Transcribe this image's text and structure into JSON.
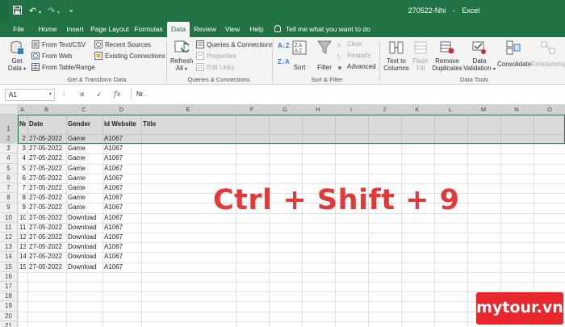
{
  "window": {
    "doc_title": "270522-Nhi",
    "app": "Excel",
    "separator": "-"
  },
  "quick_access": {
    "dropdown_icon": "customize-dropdown-icon"
  },
  "tabs": [
    "File",
    "Home",
    "Insert",
    "Page Layout",
    "Formulas",
    "Data",
    "Review",
    "View",
    "Help"
  ],
  "active_tab": "Data",
  "tell_me": "Tell me what you want to do",
  "ribbon": {
    "get_data": {
      "line1": "Get",
      "line2": "Data"
    },
    "from_text_csv": "From Text/CSV",
    "from_web": "From Web",
    "from_table_range": "From Table/Range",
    "recent_sources": "Recent Sources",
    "existing_connections": "Existing Connections",
    "refresh_all": {
      "line1": "Refresh",
      "line2": "All"
    },
    "queries_connections": "Queries & Connections",
    "properties": "Properties",
    "edit_links": "Edit Links",
    "sort": "Sort",
    "filter": "Filter",
    "clear": "Clear",
    "reapply": "Reapply",
    "advanced": "Advanced",
    "text_to_columns": {
      "line1": "Text to",
      "line2": "Columns"
    },
    "flash_fill": {
      "line1": "Flash",
      "line2": "Fill"
    },
    "remove_duplicates": {
      "line1": "Remove",
      "line2": "Duplicates"
    },
    "data_validation": {
      "line1": "Data",
      "line2": "Validation"
    },
    "consolidate": "Consolidate",
    "relationships": "Relationships",
    "groups": {
      "get_transform": "Get & Transform Data",
      "queries": "Queries & Connections",
      "sort_filter": "Sort & Filter",
      "data_tools": "Data Tools"
    }
  },
  "formula_bar": {
    "name_box": "A1",
    "fx": "fx",
    "content": "Nr."
  },
  "columns": [
    "A",
    "B",
    "C",
    "D",
    "E",
    "F",
    "G",
    "H",
    "I",
    "J",
    "K",
    "L",
    "M",
    "N",
    "O"
  ],
  "rows": [
    "1",
    "2",
    "3",
    "4",
    "5",
    "6",
    "7",
    "8",
    "9",
    "10",
    "11",
    "12",
    "13",
    "14",
    "15",
    "16",
    "17",
    "18",
    "19",
    "20",
    "21",
    "22"
  ],
  "table": {
    "headers": [
      "Nr.",
      "Date",
      "Gender",
      "Id Website",
      "Title"
    ],
    "records": [
      {
        "row": "3",
        "nr": "2",
        "date": "27-05-2022",
        "gender": "Game",
        "id": "A1067"
      },
      {
        "row": "4",
        "nr": "3",
        "date": "27-05-2022",
        "gender": "Game",
        "id": "A1067"
      },
      {
        "row": "5",
        "nr": "4",
        "date": "27-05-2022",
        "gender": "Game",
        "id": "A1067"
      },
      {
        "row": "6",
        "nr": "5",
        "date": "27-05-2022",
        "gender": "Game",
        "id": "A1067"
      },
      {
        "row": "7",
        "nr": "6",
        "date": "27-05-2022",
        "gender": "Game",
        "id": "A1067"
      },
      {
        "row": "8",
        "nr": "7",
        "date": "27-05-2022",
        "gender": "Game",
        "id": "A1067"
      },
      {
        "row": "9",
        "nr": "8",
        "date": "27-05-2022",
        "gender": "Game",
        "id": "A1067"
      },
      {
        "row": "10",
        "nr": "9",
        "date": "27-05-2022",
        "gender": "Game",
        "id": "A1067"
      },
      {
        "row": "11",
        "nr": "10",
        "date": "27-05-2022",
        "gender": "Download",
        "id": "A1067"
      },
      {
        "row": "12",
        "nr": "11",
        "date": "27-05-2022",
        "gender": "Download",
        "id": "A1067"
      },
      {
        "row": "13",
        "nr": "12",
        "date": "27-05-2022",
        "gender": "Download",
        "id": "A1067"
      },
      {
        "row": "14",
        "nr": "13",
        "date": "27-05-2022",
        "gender": "Download",
        "id": "A1067"
      },
      {
        "row": "15",
        "nr": "14",
        "date": "27-05-2022",
        "gender": "Download",
        "id": "A1067"
      },
      {
        "row": "16",
        "nr": "15",
        "date": "27-05-2022",
        "gender": "Download",
        "id": "A1067"
      }
    ]
  },
  "overlay_text": "Ctrl + Shift + 9",
  "watermark": "mytour.vn",
  "colors": {
    "excel_green": "#217346",
    "overlay_red": "#e03a3a",
    "watermark_red": "#e8262b"
  }
}
